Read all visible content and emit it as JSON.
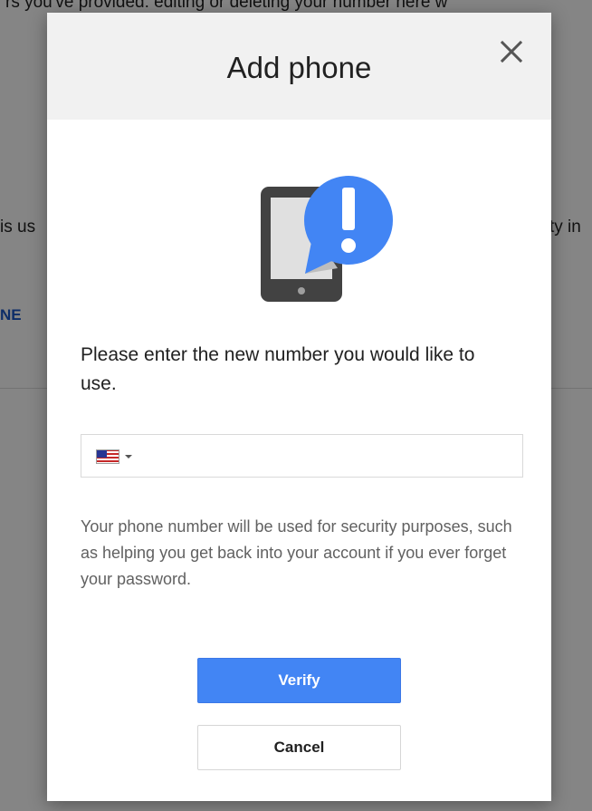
{
  "background": {
    "top_text": "rs you've provided: editing or deleting your number here w",
    "left_text": "is us",
    "right_text": "ty in",
    "link_text": "NE"
  },
  "dialog": {
    "title": "Add phone",
    "close_icon": "close-icon",
    "illustration_icon": "phone-alert-icon",
    "prompt": "Please enter the new number you would like to use.",
    "phone_input": {
      "value": "",
      "placeholder": "",
      "country_flag": "us-flag-icon"
    },
    "info": "Your phone number will be used for security purposes, such as helping you get back into your account if you ever forget your password.",
    "verify_label": "Verify",
    "cancel_label": "Cancel"
  },
  "colors": {
    "primary_button": "#4285f4",
    "alert_badge": "#4285f4",
    "header_bg": "#f1f1f1",
    "device_body": "#424242"
  }
}
